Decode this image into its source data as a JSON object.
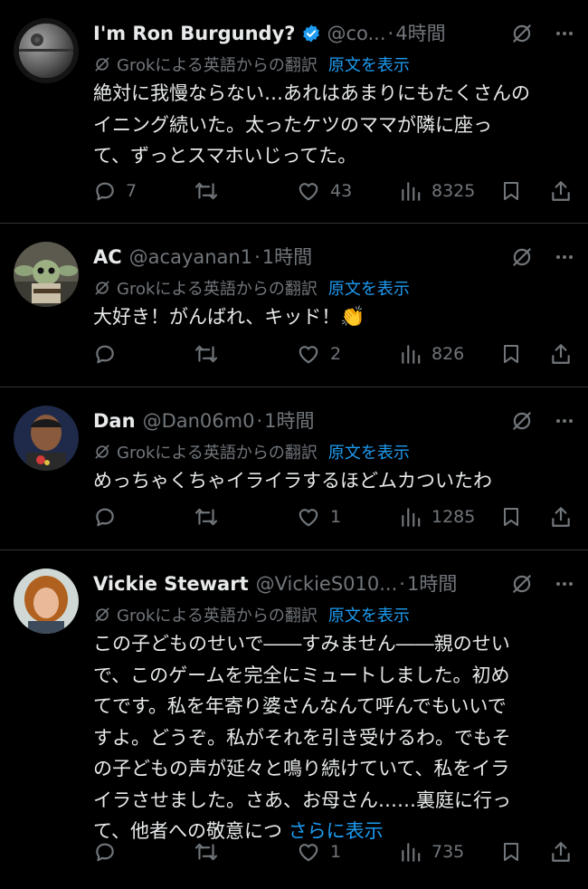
{
  "translation_prefix": "Grokによる英語からの翻訳",
  "show_original_label": "原文を表示",
  "replies": [
    {
      "name": "I'm Ron Burgundy?",
      "verified": true,
      "handle": "@co...",
      "time": "4時間",
      "body_lines": [
        "絶対に我慢ならない…あれはあまりにもたくさんの",
        "イニング続いた。太ったケツのママが隣に座っ",
        "て、ずっとスマホいじってた。"
      ],
      "replies_count": "7",
      "reposts_count": "",
      "likes_count": "43",
      "views_count": "8325",
      "avatar": "death-star-avatar"
    },
    {
      "name": "AC",
      "verified": false,
      "handle": "@acayanan1",
      "time": "1時間",
      "body_lines": [
        "大好き！がんばれ、キッド！"
      ],
      "body_emoji": "👏",
      "replies_count": "",
      "reposts_count": "",
      "likes_count": "2",
      "views_count": "826",
      "avatar": "baby-yoda-avatar"
    },
    {
      "name": "Dan",
      "verified": false,
      "handle": "@Dan06m0",
      "time": "1時間",
      "body_lines": [
        "めっちゃくちゃイライラするほどムカついたわ"
      ],
      "replies_count": "",
      "reposts_count": "",
      "likes_count": "1",
      "views_count": "1285",
      "avatar": "man-avatar"
    },
    {
      "name": "Vickie Stewart",
      "verified": false,
      "handle": "@VickieS010...",
      "time": "1時間",
      "body_lines": [
        "この子どものせいで――すみません――親のせい",
        "で、このゲームを完全にミュートしました。初め",
        "てです。私を年寄り婆さんなんて呼んでもいいで",
        "すよ。どうぞ。私がそれを引き受けるわ。でもそ",
        "の子どもの声が延々と鳴り続けていて、私をイラ",
        "イラさせました。さあ、お母さん……裏庭に行っ",
        "て、他者への敬意につ"
      ],
      "show_more": "さらに表示",
      "replies_count": "",
      "reposts_count": "",
      "likes_count": "1",
      "views_count": "735",
      "avatar": "woman-avatar"
    }
  ]
}
